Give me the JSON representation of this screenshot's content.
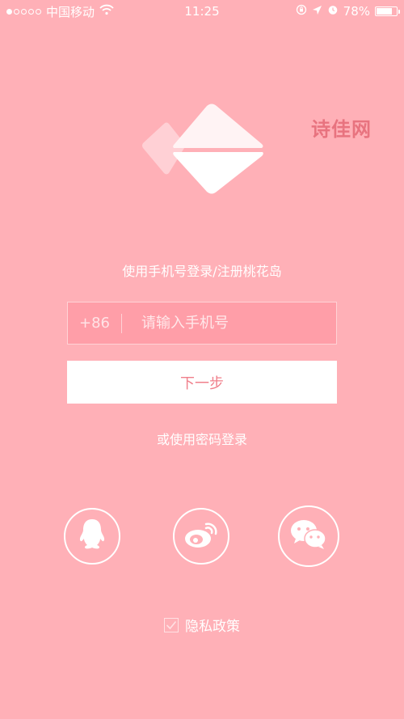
{
  "status_bar": {
    "carrier": "中国移动",
    "time": "11:25",
    "battery": "78%",
    "battery_level": 0.78,
    "signal_strength": 1,
    "signal_total": 5,
    "icons": [
      "wifi-icon",
      "lock-rotation-icon",
      "location-arrow-icon",
      "alarm-icon",
      "battery-icon"
    ]
  },
  "watermark": "诗佳网",
  "colors": {
    "background": "#ffb0b7",
    "accent": "#f07f8b",
    "watermark": "#e8737f"
  },
  "subtitle": "使用手机号登录/注册桃花岛",
  "phone": {
    "country_code": "+86",
    "placeholder": "请输入手机号",
    "value": ""
  },
  "next_button_label": "下一步",
  "password_login": "或使用密码登录",
  "social_logins": [
    "qq-icon",
    "weibo-icon",
    "wechat-icon"
  ],
  "privacy": {
    "label": "隐私政策",
    "checked": true
  }
}
